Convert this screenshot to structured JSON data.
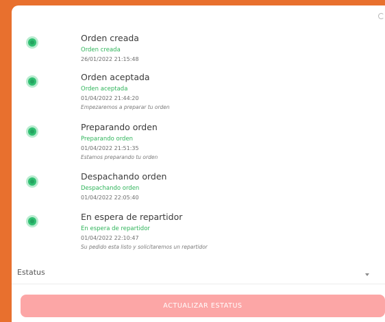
{
  "steps": [
    {
      "title": "Orden creada",
      "status": "Orden creada",
      "date": "26/01/2022 21:15:48",
      "note": ""
    },
    {
      "title": "Orden aceptada",
      "status": "Orden aceptada",
      "date": "01/04/2022 21:44:20",
      "note": "Empezaremos a preparar tu orden"
    },
    {
      "title": "Preparando orden",
      "status": "Preparando orden",
      "date": "01/04/2022 21:51:35",
      "note": "Estamos preparando tu orden"
    },
    {
      "title": "Despachando orden",
      "status": "Despachando orden",
      "date": "01/04/2022 22:05:40",
      "note": ""
    },
    {
      "title": "En espera de repartidor",
      "status": "En espera de repartidor",
      "date": "01/04/2022 22:10:47",
      "note": "Su pedido esta listo y solicitaremos un repartidor"
    }
  ],
  "status_select": {
    "label": "Estatus"
  },
  "update_button": {
    "label": "ACTUALIZAR ESTATUS"
  },
  "colors": {
    "background": "#e8702e",
    "status_green": "#2fb45a",
    "button": "#fca6a6"
  }
}
